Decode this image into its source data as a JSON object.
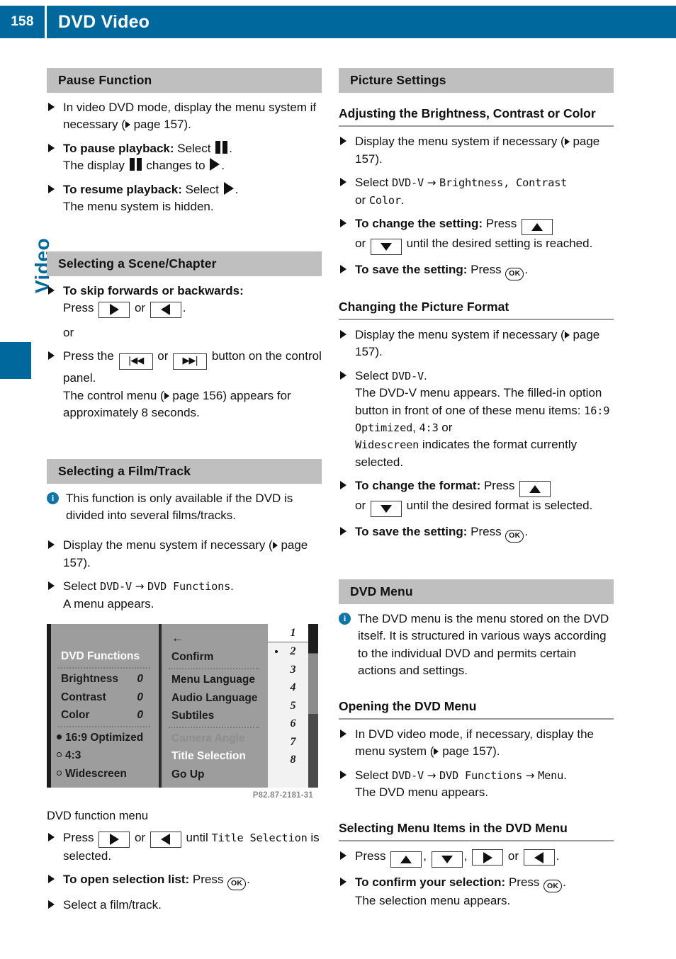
{
  "header": {
    "page_number": "158",
    "title": "DVD Video"
  },
  "chapter_tab": {
    "label": "Video"
  },
  "left_column": {
    "pause_function": {
      "heading": "Pause Function",
      "item1_text": "In video DVD mode, display the menu system if necessary (",
      "item1_pageref": " page 157).",
      "item2_bold": "To pause playback:",
      "item2_text": " Select",
      "item2_after": ".",
      "item2_line2_pre": "The display",
      "item2_line2_mid": "changes to",
      "item2_line2_post": ".",
      "item3_bold": "To resume playback:",
      "item3_text": " Select",
      "item3_after": ".",
      "item3_line2": "The menu system is hidden."
    },
    "scene_chapter": {
      "heading": "Selecting a Scene/Chapter",
      "item1_bold": "To skip forwards or backwards:",
      "item1_line2_pre": "Press",
      "item1_line2_mid": "or",
      "item1_line2_post": ".",
      "or_text": "or",
      "item2_pre": "Press the",
      "item2_mid": "or",
      "item2_post": "button on the control panel.",
      "item2_line2_pre": "The control menu (",
      "item2_line2_post": " page 156) appears for approximately 8 seconds."
    },
    "film_track": {
      "heading": "Selecting a Film/Track",
      "info_text": "This function is only available if the DVD is divided into several films/tracks.",
      "item1_text": "Display the menu system if necessary (",
      "item1_pageref": " page 157).",
      "item2_pre": "Select ",
      "item2_mono1": "DVD-V",
      "item2_arrow": " → ",
      "item2_mono2": "DVD Functions",
      "item2_post": ".",
      "item2_line2": "A menu appears.",
      "figure_credit": "P82.87-2181-31",
      "figure_caption": "DVD function menu",
      "item3_pre": "Press",
      "item3_mid": "or",
      "item3_post": "until ",
      "item3_mono": "Title Selection",
      "item3_tail": " is selected.",
      "item4_bold": "To open selection list:",
      "item4_text": " Press",
      "item4_after": ".",
      "item5_text": "Select a film/track."
    }
  },
  "dvd_menu_figure": {
    "column_left": {
      "title": "DVD Functions",
      "rows": [
        {
          "label": "Brightness",
          "value": "0"
        },
        {
          "label": "Contrast",
          "value": "0"
        },
        {
          "label": "Color",
          "value": "0"
        }
      ],
      "options": [
        {
          "label": "16:9 Optimized",
          "selected": true
        },
        {
          "label": "4:3",
          "selected": false
        },
        {
          "label": "Widescreen",
          "selected": false
        }
      ]
    },
    "column_middle": {
      "back_arrow": "←",
      "items": [
        {
          "label": "Confirm",
          "state": "normal"
        },
        {
          "label": "Menu Language",
          "state": "normal"
        },
        {
          "label": "Audio Language",
          "state": "normal"
        },
        {
          "label": "Subtiles",
          "state": "normal"
        },
        {
          "label": "Camera Angle",
          "state": "disabled"
        },
        {
          "label": "Title Selection",
          "state": "highlighted"
        },
        {
          "label": "Go Up",
          "state": "normal"
        }
      ]
    },
    "column_right": {
      "numbers": [
        "1",
        "2",
        "3",
        "4",
        "5",
        "6",
        "7",
        "8"
      ],
      "marked": "2",
      "scroll_up": "▲",
      "scroll_down": "▼"
    }
  },
  "right_column": {
    "picture_settings": {
      "heading": "Picture Settings",
      "sub1": {
        "title": "Adjusting the Brightness, Contrast or Color",
        "item1_text": "Display the menu system if necessary (",
        "item1_pageref": " page 157).",
        "item2_pre": "Select ",
        "item2_mono1": "DVD-V",
        "item2_arrow": " → ",
        "item2_mono2": "Brightness",
        "item2_comma": ", ",
        "item2_mono3": "Contrast",
        "item2_or": " or ",
        "item2_mono4": "Color",
        "item2_post": ".",
        "item3_bold": "To change the setting:",
        "item3_text": " Press",
        "item3_line2_pre": "or",
        "item3_line2_post": "until the desired setting is reached.",
        "item4_bold": "To save the setting:",
        "item4_text": " Press",
        "item4_after": "."
      },
      "sub2": {
        "title": "Changing the Picture Format",
        "item1_text": "Display the menu system if necessary (",
        "item1_pageref": " page 157).",
        "item2_pre": "Select ",
        "item2_mono1": "DVD-V",
        "item2_post": ".",
        "item2_body_pre": "The DVD-V menu appears. The filled-in option button in front of one of these menu items: ",
        "item2_mono2": "16:9 Optimized",
        "item2_comma": ", ",
        "item2_mono3": "4:3",
        "item2_or": " or ",
        "item2_mono4": "Widescreen",
        "item2_body_post": " indicates the format currently selected.",
        "item3_bold": "To change the format:",
        "item3_text": " Press",
        "item3_line2_pre": "or",
        "item3_line2_post": "until the desired format is selected.",
        "item4_bold": "To save the setting:",
        "item4_text": " Press",
        "item4_after": "."
      }
    },
    "dvd_menu": {
      "heading": "DVD Menu",
      "info_text": "The DVD menu is the menu stored on the DVD itself. It is structured in various ways according to the individual DVD and permits certain actions and settings.",
      "sub1": {
        "title": "Opening the DVD Menu",
        "item1_text": "In DVD video mode, if necessary, display the menu system (",
        "item1_pageref": " page 157).",
        "item2_pre": "Select ",
        "item2_mono1": "DVD-V",
        "item2_arrow1": " → ",
        "item2_mono2": "DVD Functions",
        "item2_arrow2": " → ",
        "item2_mono3": "Menu",
        "item2_post": ".",
        "item2_line2": "The DVD menu appears."
      },
      "sub2": {
        "title": "Selecting Menu Items in the DVD Menu",
        "item1_pre": "Press",
        "item1_sep1": ",",
        "item1_sep2": ",",
        "item1_or": "or",
        "item1_post": ".",
        "item2_bold": "To confirm your selection:",
        "item2_text": " Press",
        "item2_after": ".",
        "item2_line2": "The selection menu appears."
      }
    }
  },
  "glyphs": {
    "ok_label": "OK",
    "skip_back": "⏮",
    "skip_fwd": "⏭"
  },
  "colors": {
    "brand_blue": "#00689c",
    "section_gray": "#bfbfbf",
    "info_blue": "#0d76a8"
  }
}
